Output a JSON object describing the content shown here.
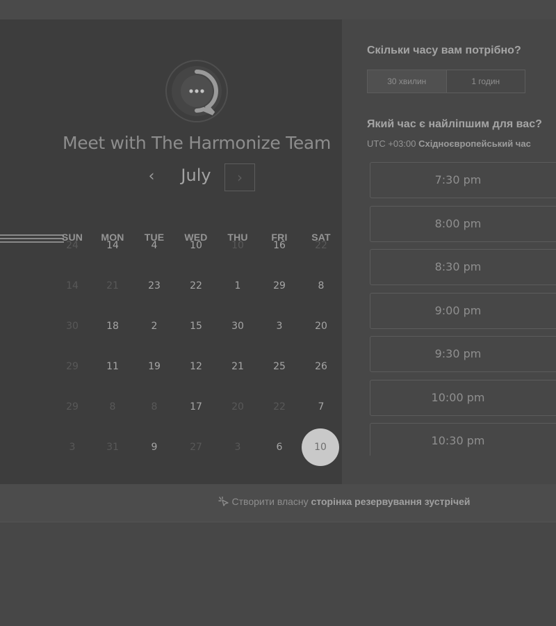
{
  "calendar": {
    "title": "Meet with The Harmonize Team",
    "month": "July",
    "prev_icon": "‹",
    "next_icon": "›",
    "weekdays": [
      "SUN",
      "MON",
      "TUE",
      "WED",
      "THU",
      "FRI",
      "SAT"
    ],
    "weeks": [
      [
        {
          "d": "24",
          "muted": true
        },
        {
          "d": "14"
        },
        {
          "d": "4"
        },
        {
          "d": "10"
        },
        {
          "d": "10",
          "muted": true
        },
        {
          "d": "16"
        },
        {
          "d": "22",
          "muted": true
        }
      ],
      [
        {
          "d": "14",
          "muted": true
        },
        {
          "d": "21",
          "muted": true
        },
        {
          "d": "23"
        },
        {
          "d": "22"
        },
        {
          "d": "1"
        },
        {
          "d": "29"
        },
        {
          "d": "8"
        }
      ],
      [
        {
          "d": "30",
          "muted": true
        },
        {
          "d": "18"
        },
        {
          "d": "2"
        },
        {
          "d": "15"
        },
        {
          "d": "30"
        },
        {
          "d": "3"
        },
        {
          "d": "20"
        }
      ],
      [
        {
          "d": "29",
          "muted": true
        },
        {
          "d": "11"
        },
        {
          "d": "19"
        },
        {
          "d": "12"
        },
        {
          "d": "21"
        },
        {
          "d": "25"
        },
        {
          "d": "26"
        }
      ],
      [
        {
          "d": "29",
          "muted": true
        },
        {
          "d": "8",
          "muted": true
        },
        {
          "d": "8",
          "muted": true
        },
        {
          "d": "17"
        },
        {
          "d": "20",
          "muted": true
        },
        {
          "d": "22",
          "muted": true
        },
        {
          "d": "7"
        }
      ],
      [
        {
          "d": "3",
          "muted": true
        },
        {
          "d": "31",
          "muted": true
        },
        {
          "d": "9"
        },
        {
          "d": "27",
          "muted": true
        },
        {
          "d": "3",
          "muted": true
        },
        {
          "d": "6"
        },
        {
          "d": "10",
          "selected": true
        }
      ]
    ]
  },
  "booking": {
    "duration_question": "Скільки часу вам потрібно?",
    "duration_options": [
      "30 хвилин",
      "1 годин"
    ],
    "time_question": "Який час є найліпшим для вас?",
    "timezone_prefix": "UTC +03:00",
    "timezone_name": "Східноєвропейський час",
    "slots": [
      "7:30 pm",
      "8:00 pm",
      "8:30 pm",
      "9:00 pm",
      "9:30 pm",
      "10:00 pm",
      "10:30 pm"
    ]
  },
  "footer": {
    "link_prefix": "Створити власну",
    "link_bold": "сторінка резервування зустрічей"
  },
  "colors": {
    "background": "#474747",
    "calendar_panel": "#3d3d3d",
    "selected_day": "#c9c9c9"
  },
  "icons": {
    "logo": "chat-bubble-logo-icon",
    "footer": "sparkle-arrow-icon"
  }
}
